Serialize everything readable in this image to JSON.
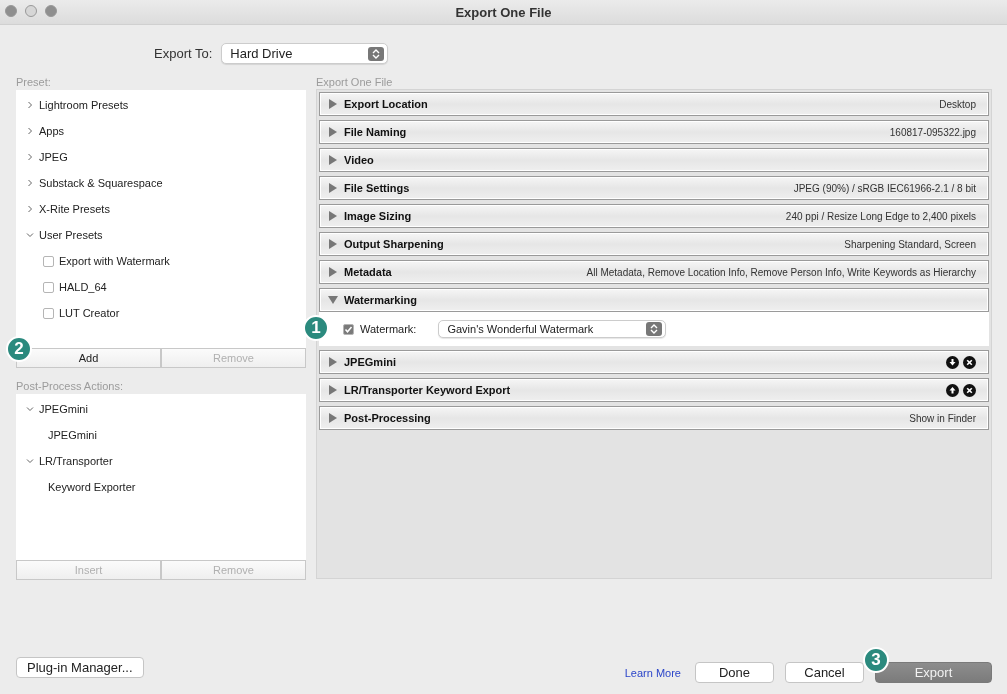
{
  "window": {
    "title": "Export One File"
  },
  "export_to": {
    "label": "Export To:",
    "value": "Hard Drive"
  },
  "preset": {
    "label": "Preset:",
    "items": [
      {
        "label": "Lightroom Presets",
        "expanded": false
      },
      {
        "label": "Apps",
        "expanded": false
      },
      {
        "label": "JPEG",
        "expanded": false
      },
      {
        "label": "Substack & Squarespace",
        "expanded": false
      },
      {
        "label": "X-Rite Presets",
        "expanded": false
      },
      {
        "label": "User Presets",
        "expanded": true,
        "children": [
          {
            "label": "Export with Watermark",
            "checked": false
          },
          {
            "label": "HALD_64",
            "checked": false
          },
          {
            "label": "LUT Creator",
            "checked": false
          }
        ]
      }
    ],
    "buttons": [
      {
        "label": "Add",
        "disabled": false,
        "badge": "2"
      },
      {
        "label": "Remove",
        "disabled": true
      }
    ]
  },
  "post_process": {
    "label": "Post-Process Actions:",
    "items": [
      {
        "label": "JPEGmini",
        "expanded": true,
        "children": [
          {
            "label": "JPEGmini"
          }
        ]
      },
      {
        "label": "LR/Transporter",
        "expanded": true,
        "children": [
          {
            "label": "Keyword Exporter"
          }
        ]
      }
    ],
    "buttons": [
      {
        "label": "Insert",
        "disabled": true
      },
      {
        "label": "Remove",
        "disabled": true
      }
    ]
  },
  "panel": {
    "title": "Export One File",
    "sections": [
      {
        "title": "Export Location",
        "summary": "Desktop",
        "expanded": false
      },
      {
        "title": "File Naming",
        "summary": "160817-095322.jpg",
        "expanded": false
      },
      {
        "title": "Video",
        "expanded": false
      },
      {
        "title": "File Settings",
        "summary": "JPEG (90%) / sRGB IEC61966-2.1 / 8 bit",
        "expanded": false
      },
      {
        "title": "Image Sizing",
        "summary": "240 ppi / Resize Long Edge to 2,400 pixels",
        "expanded": false
      },
      {
        "title": "Output Sharpening",
        "summary": "Sharpening Standard, Screen",
        "expanded": false
      },
      {
        "title": "Metadata",
        "summary": "All Metadata, Remove Location Info, Remove Person Info, Write Keywords as Hierarchy",
        "expanded": false
      },
      {
        "title": "Watermarking",
        "expanded": true,
        "watermark": {
          "checked": true,
          "label": "Watermark:",
          "value": "Gavin's Wonderful Watermark",
          "badge": "1"
        }
      },
      {
        "title": "JPEGmini",
        "expanded": false,
        "actions": [
          {
            "kind": "down"
          },
          {
            "kind": "remove"
          }
        ]
      },
      {
        "title": "LR/Transporter Keyword Export",
        "expanded": false,
        "actions": [
          {
            "kind": "up"
          },
          {
            "kind": "remove"
          }
        ]
      },
      {
        "title": "Post-Processing",
        "summary": "Show in Finder",
        "expanded": false
      }
    ]
  },
  "footer": {
    "plugin_button": "Plug-in Manager...",
    "link": "Learn More",
    "buttons": [
      {
        "label": "Done",
        "kind": "normal"
      },
      {
        "label": "Cancel",
        "kind": "normal"
      },
      {
        "label": "Export",
        "kind": "primary",
        "badge": "3"
      }
    ]
  }
}
